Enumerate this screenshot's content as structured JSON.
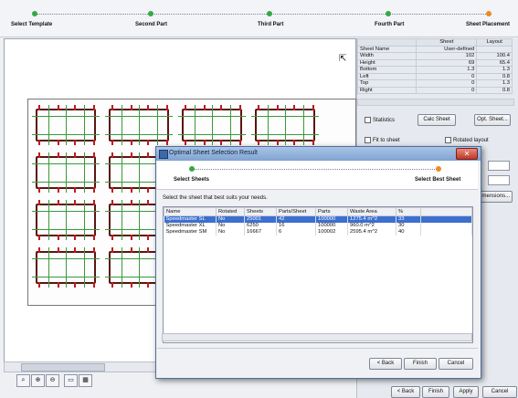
{
  "wizard": {
    "steps": [
      {
        "label": "Select Template",
        "state": "done"
      },
      {
        "label": "Second Part",
        "state": "done"
      },
      {
        "label": "Third Part",
        "state": "done"
      },
      {
        "label": "Fourth Part",
        "state": "done"
      },
      {
        "label": "Sheet Placement",
        "state": "current"
      }
    ]
  },
  "sheet_table": {
    "headers": [
      "",
      "Sheet",
      "Layout"
    ],
    "rows": [
      [
        "Sheet Name",
        "User-defined",
        ""
      ],
      [
        "Width",
        "102",
        "100.4"
      ],
      [
        "Height",
        "69",
        "65.4"
      ],
      [
        "Bottom",
        "1.3",
        "1.3"
      ],
      [
        "Left",
        "0",
        "0.8"
      ],
      [
        "Top",
        "0",
        "1.3"
      ],
      [
        "Right",
        "0",
        "0.8"
      ]
    ]
  },
  "panel": {
    "statistics_label": "Statistics",
    "calc_sheet_label": "Calc Sheet",
    "opt_sheet_label": "Opt. Sheet...",
    "fit_to_sheet_label": "Fit to sheet",
    "rotated_layout_label": "Rotated layout",
    "dimensions_label": "Dimensions..."
  },
  "dialog": {
    "title": "Optimal Sheet Selection Result",
    "step_left": "Select Sheets",
    "step_right": "Select Best Sheet",
    "instruction": "Select the sheet that best suits your needs.",
    "columns": [
      "Name",
      "Rotated",
      "Sheets",
      "Parts/Sheet",
      "Parts",
      "Waste Area",
      "%"
    ],
    "rows": [
      [
        "Speedmaster SL",
        "No",
        "25001",
        "42",
        "100000",
        "1275.4 m^2",
        "33"
      ],
      [
        "Speedmaster XL",
        "No",
        "6250",
        "16",
        "100000",
        "960.0 m^2",
        "30"
      ],
      [
        "Speedmaster SM",
        "No",
        "16667",
        "6",
        "100002",
        "2595.4 m^2",
        "40"
      ]
    ],
    "back_label": "< Back",
    "finish_label": "Finish",
    "cancel_label": "Cancel"
  },
  "footer": {
    "back_label": "< Back",
    "finish_label": "Finish",
    "apply_label": "Apply",
    "cancel_label": "Cancel"
  },
  "tools": [
    "zoom-fit-icon",
    "zoom-in-icon",
    "zoom-out-icon",
    "ruler-icon",
    "grid-icon"
  ]
}
